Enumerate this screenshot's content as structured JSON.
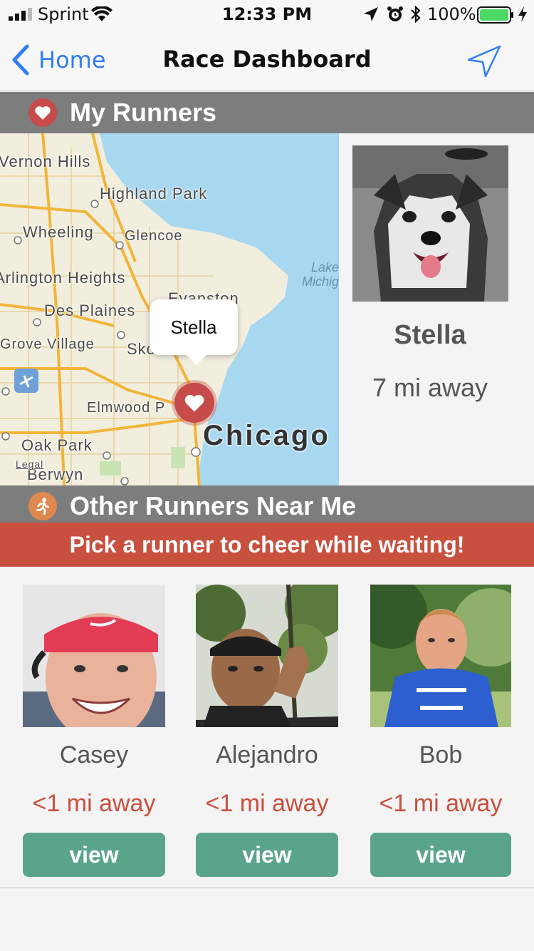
{
  "status_bar": {
    "carrier": "Sprint",
    "time": "12:33 PM",
    "battery_percent": "100%"
  },
  "nav": {
    "back_label": "Home",
    "title": "Race Dashboard"
  },
  "my_runners": {
    "header": "My Runners",
    "map": {
      "places": [
        "Vernon Hills",
        "Highland Park",
        "Wheeling",
        "Glencoe",
        "Arlington Heights",
        "Evanston",
        "Des Plaines",
        "Skokie",
        "Grove Village",
        "Elmwood P",
        "Oak Park",
        "Berwyn",
        "Chicago",
        "Lake Michig",
        "Legal"
      ],
      "callout": "Stella"
    },
    "runner": {
      "name": "Stella",
      "distance": "7 mi away"
    }
  },
  "other_runners": {
    "header": "Other Runners Near Me",
    "banner": "Pick a runner to cheer while waiting!",
    "runners": [
      {
        "name": "Casey",
        "distance": "<1 mi away",
        "button": "view"
      },
      {
        "name": "Alejandro",
        "distance": "<1 mi away",
        "button": "view"
      },
      {
        "name": "Bob",
        "distance": "<1 mi away",
        "button": "view"
      }
    ]
  },
  "colors": {
    "accent_blue": "#2f7ef6",
    "header_gray": "#7d7d7d",
    "banner_red": "#c8503f",
    "button_green": "#5aa58a",
    "heart_red": "#c74b4b",
    "runner_orange": "#e0894f"
  },
  "icons": {
    "back": "chevron-left-icon",
    "send": "location-arrow-icon",
    "my_runners": "heart-icon",
    "other_runners": "runner-icon",
    "map_pin": "heart-pin-icon"
  }
}
